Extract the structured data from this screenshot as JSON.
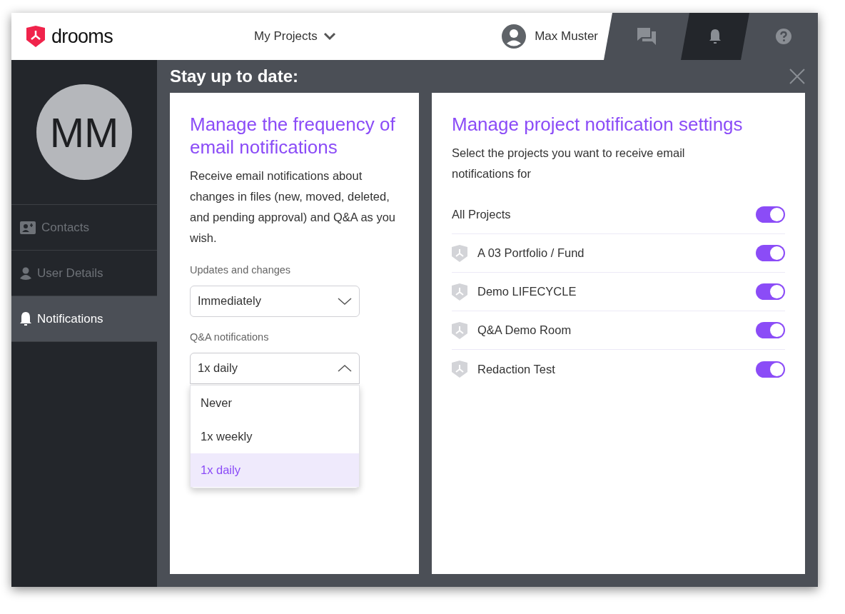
{
  "header": {
    "logo": "drooms",
    "projects_menu": "My Projects",
    "user": "Max Muster",
    "tabs": [
      {
        "kind": "chat",
        "selected": false
      },
      {
        "kind": "bell",
        "selected": true
      },
      {
        "kind": "help",
        "selected": false
      }
    ]
  },
  "sidebar": {
    "avatar_initials": "MM",
    "items": [
      {
        "kind": "contacts",
        "label": "Contacts",
        "selected": false
      },
      {
        "kind": "user",
        "label": "User Details",
        "selected": false
      },
      {
        "kind": "bell",
        "label": "Notifications",
        "selected": true
      }
    ]
  },
  "page_title": "Stay up to date:",
  "frequency_card": {
    "title": "Manage the frequency of email notifications",
    "description": "Receive email notifications about changes in files (new, moved, deleted, and pending approval) and Q&A as you wish.",
    "fields": [
      {
        "label": "Updates and changes",
        "value": "Immediately",
        "expanded": false
      },
      {
        "label": "Q&A notifications",
        "value": "1x daily",
        "expanded": true,
        "options": [
          {
            "label": "Never",
            "selected": false
          },
          {
            "label": "1x weekly",
            "selected": false
          },
          {
            "label": "1x daily",
            "selected": true
          }
        ]
      }
    ]
  },
  "projects_card": {
    "title": "Manage project notification settings",
    "description": "Select the projects you want to receive email notifications for",
    "rows": [
      {
        "kind": "all",
        "name": "All Projects",
        "on": true
      },
      {
        "kind": "project",
        "name": "A 03 Portfolio / Fund",
        "on": true
      },
      {
        "kind": "project",
        "name": "Demo LIFECYCLE",
        "on": true
      },
      {
        "kind": "project",
        "name": "Q&A Demo Room",
        "on": true
      },
      {
        "kind": "project",
        "name": "Redaction Test",
        "on": true
      }
    ]
  }
}
